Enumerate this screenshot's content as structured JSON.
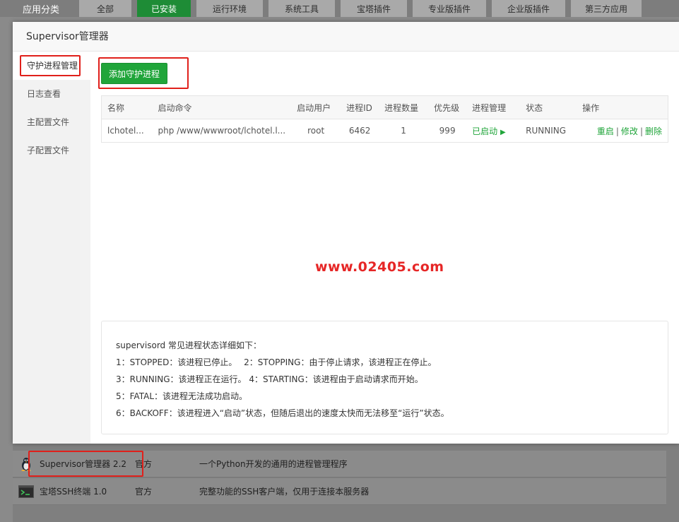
{
  "category_bar": {
    "label": "应用分类",
    "tabs": [
      {
        "label": "全部",
        "active": false
      },
      {
        "label": "已安装",
        "active": true
      },
      {
        "label": "运行环境",
        "active": false
      },
      {
        "label": "系统工具",
        "active": false
      },
      {
        "label": "宝塔插件",
        "active": false
      },
      {
        "label": "专业版插件",
        "active": false
      },
      {
        "label": "企业版插件",
        "active": false
      },
      {
        "label": "第三方应用",
        "active": false
      }
    ]
  },
  "background_list": [
    {
      "icon": "linux-penguin-icon",
      "name": "Supervisor管理器 2.2",
      "type": "官方",
      "desc": "一个Python开发的通用的进程管理程序"
    },
    {
      "icon": "terminal-icon",
      "name": "宝塔SSH终端 1.0",
      "type": "官方",
      "desc": "完整功能的SSH客户端，仅用于连接本服务器"
    }
  ],
  "modal": {
    "title": "Supervisor管理器",
    "sidebar": [
      "守护进程管理",
      "日志查看",
      "主配置文件",
      "子配置文件"
    ],
    "active_sidebar_index": 0,
    "add_button": "添加守护进程",
    "table": {
      "headers": {
        "name": "名称",
        "command": "启动命令",
        "user": "启动用户",
        "pid": "进程ID",
        "count": "进程数量",
        "priority": "优先级",
        "manage": "进程管理",
        "status": "状态",
        "actions": "操作"
      },
      "rows": [
        {
          "name": "lchotel...",
          "command": "php /www/wwwroot/lchotel.l...",
          "user": "root",
          "pid": "6462",
          "count": "1",
          "priority": "999",
          "manage": "已启动",
          "status": "RUNNING",
          "action_restart": "重启",
          "action_edit": "修改",
          "action_delete": "删除",
          "action_sep": "|"
        }
      ]
    },
    "watermark": "www.02405.com",
    "info_lines": [
      "supervisord 常见进程状态详细如下：",
      "1：STOPPED：该进程已停止。　 2：STOPPING：由于停止请求，该进程正在停止。",
      "3：RUNNING：该进程正在运行。 4：STARTING：该进程由于启动请求而开始。",
      "5：FATAL：该进程无法成功启动。",
      "6：BACKOFF：该进程进入“启动”状态，但随后退出的速度太快而无法移至“运行”状态。"
    ]
  },
  "colors": {
    "accent_green": "#20a53a",
    "highlight_red": "#e0201b",
    "watermark_red": "#e62626"
  }
}
